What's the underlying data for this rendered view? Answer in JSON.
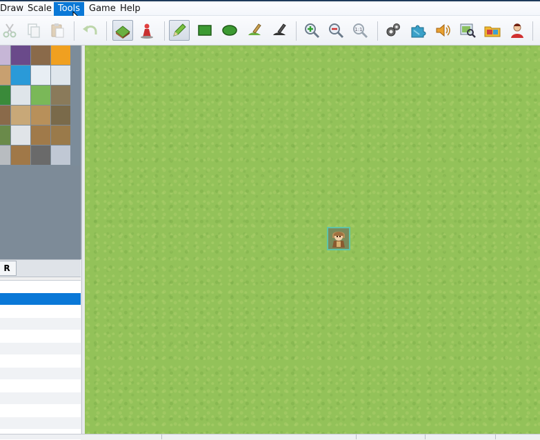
{
  "menu": {
    "items": [
      {
        "label": "Draw",
        "active": false
      },
      {
        "label": "Scale",
        "active": false
      },
      {
        "label": "Tools",
        "active": true
      },
      {
        "label": "Game",
        "active": false
      },
      {
        "label": "Help",
        "active": false
      }
    ]
  },
  "toolbar": {
    "buttons": [
      {
        "icon": "scissors-icon",
        "state": "disabled"
      },
      {
        "icon": "copy-icon",
        "state": "disabled"
      },
      {
        "icon": "paste-icon",
        "state": "disabled"
      },
      {
        "icon": "undo-icon",
        "state": "disabled"
      },
      {
        "icon": "map-layer-icon",
        "state": "pressed"
      },
      {
        "icon": "event-layer-icon",
        "state": "normal"
      },
      {
        "icon": "pencil-icon",
        "state": "pressed"
      },
      {
        "icon": "rectangle-icon",
        "state": "normal"
      },
      {
        "icon": "ellipse-icon",
        "state": "normal"
      },
      {
        "icon": "fill-icon",
        "state": "normal"
      },
      {
        "icon": "shadow-pen-icon",
        "state": "normal"
      },
      {
        "icon": "zoom-in-icon",
        "state": "normal"
      },
      {
        "icon": "zoom-out-icon",
        "state": "normal"
      },
      {
        "icon": "zoom-actual-icon",
        "state": "normal"
      },
      {
        "icon": "database-icon",
        "state": "normal"
      },
      {
        "icon": "plugin-manager-icon",
        "state": "normal"
      },
      {
        "icon": "sound-test-icon",
        "state": "normal"
      },
      {
        "icon": "event-searcher-icon",
        "state": "normal"
      },
      {
        "icon": "resource-manager-icon",
        "state": "normal"
      },
      {
        "icon": "character-generator-icon",
        "state": "normal"
      }
    ]
  },
  "tileset": {
    "tab_label": "R"
  },
  "map": {
    "selected_row": 1,
    "row_count": 12
  },
  "colors": {
    "menu_highlight": "#0a78d7",
    "grass": "#93c259",
    "event_border": "#5fc4a8"
  }
}
